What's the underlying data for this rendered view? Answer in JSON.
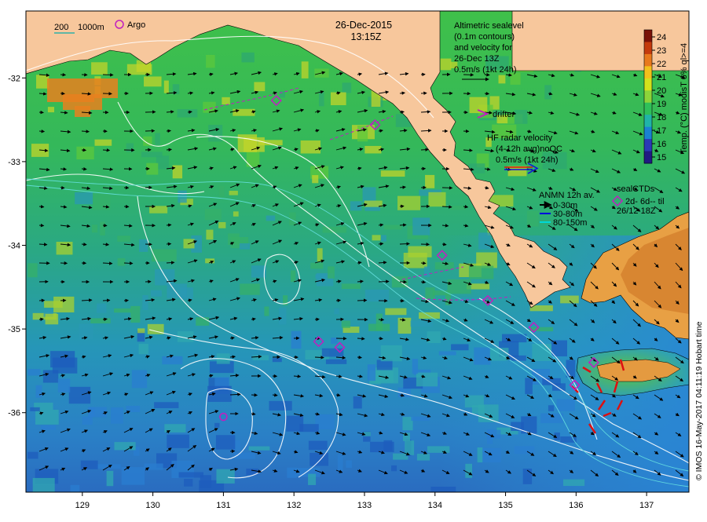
{
  "title": {
    "date": "26-Dec-2015",
    "time": "13:15Z"
  },
  "scale_bar": {
    "label_200": "200",
    "label_1000": "1000m"
  },
  "argo_legend": {
    "label": "Argo"
  },
  "altimetry_legend": {
    "lines": [
      "Altimetric sealevel",
      "(0.1m contours)",
      "and velocity for",
      "26-Dec 13Z",
      "0.5m/s (1kt 24h)"
    ]
  },
  "drifter_legend": {
    "label": "drifter"
  },
  "hf_radar_legend": {
    "lines": [
      "HF radar velocity",
      "(4-12h avg)noQC",
      "0.5m/s (1kt 24h)"
    ]
  },
  "anmn_legend": {
    "title": "ANMN 12h av.",
    "items": [
      {
        "label": "0-30m",
        "color": "#000000"
      },
      {
        "label": "30-80m",
        "color": "#0000dd"
      },
      {
        "label": "80-150m",
        "color": "#00d8d8"
      }
    ]
  },
  "sealctd_legend": {
    "title": "sealCTDs",
    "line1": "2d- 6d-- til",
    "line2": "26/12 18Z"
  },
  "colorbar": {
    "ticks": [
      "24",
      "23",
      "22",
      "21",
      "20",
      "19",
      "18",
      "17",
      "16",
      "15"
    ],
    "label": "Temp. (°C) modisT 6% ql>=4",
    "colors": [
      "#7a1208",
      "#c43a0c",
      "#e8781c",
      "#f2c01c",
      "#d2e21c",
      "#8cd43a",
      "#2ec05a",
      "#20b4a8",
      "#1a82d2",
      "#2a3ab6",
      "#201a82"
    ]
  },
  "credit": {
    "text": "© IMOS 16-May-2017 04:11:19 Hobart time"
  },
  "axes": {
    "x_ticks": [
      "129",
      "130",
      "131",
      "132",
      "133",
      "134",
      "135",
      "136",
      "137"
    ],
    "y_ticks": [
      "-32",
      "-33",
      "-34",
      "-35",
      "-36"
    ]
  },
  "map_data": {
    "lon_range": [
      128.2,
      137.6
    ],
    "lat_range": [
      -36.95,
      -31.2
    ],
    "argo_floats": [
      {
        "lon": 131.0,
        "lat": -36.05
      }
    ],
    "sealctd_markers": [
      {
        "lon": 131.75,
        "lat": -32.27
      },
      {
        "lon": 133.15,
        "lat": -32.56
      },
      {
        "lon": 134.1,
        "lat": -34.12
      },
      {
        "lon": 134.75,
        "lat": -34.66
      },
      {
        "lon": 135.4,
        "lat": -34.98
      },
      {
        "lon": 136.25,
        "lat": -35.4
      },
      {
        "lon": 132.35,
        "lat": -35.15
      },
      {
        "lon": 132.65,
        "lat": -35.22
      },
      {
        "lon": 135.98,
        "lat": -35.67
      }
    ]
  }
}
